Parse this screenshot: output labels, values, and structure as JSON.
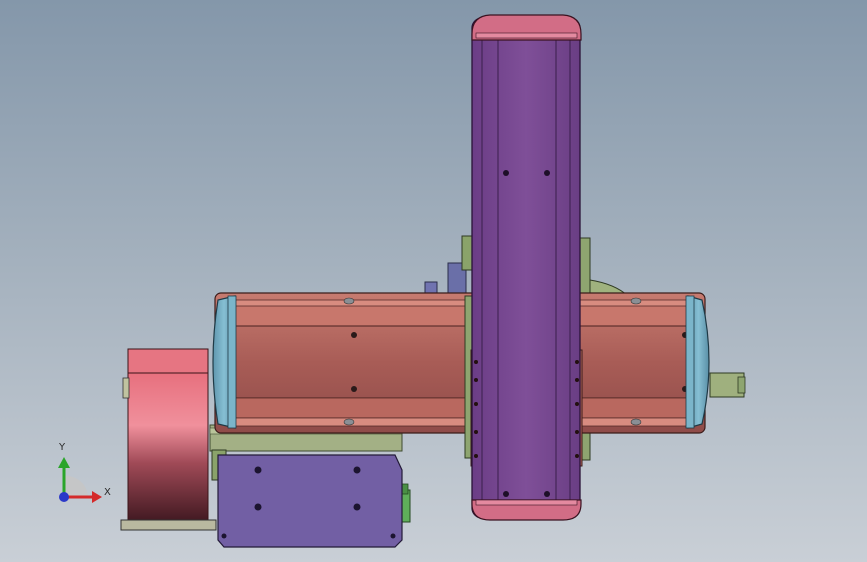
{
  "viewport": {
    "background_top": "#8497aa",
    "background_bottom": "#c9cfd6"
  },
  "model": {
    "colors": {
      "vertical_axis_body": "#7a4e92",
      "vertical_axis_cap": "#cf6c86",
      "horizontal_axis_body": "#b4675f",
      "horizontal_axis_end": "#6fa8c0",
      "motor_housing": "#c55a6a",
      "base_plate": "#9aa77d",
      "bracket": "#705d9e",
      "clamp_bar": "#8c8c5a"
    }
  },
  "triad": {
    "x_label": "X",
    "y_label": "Y",
    "x_color": "#d42a2a",
    "y_color": "#2aa52a",
    "z_color": "#2a38c8"
  }
}
